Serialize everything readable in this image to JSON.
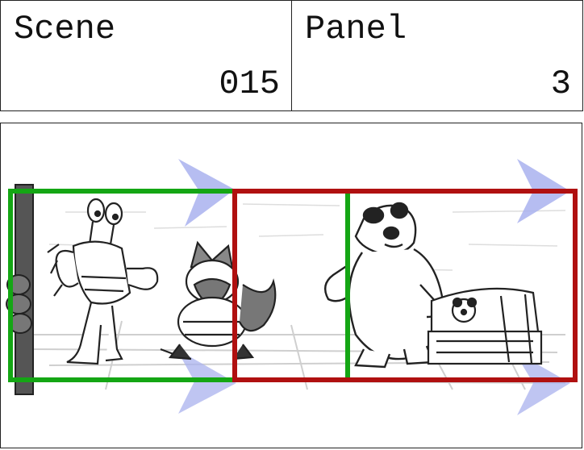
{
  "scene": {
    "label": "Scene",
    "number": "015"
  },
  "panel": {
    "label": "Panel",
    "number": "3"
  },
  "colors": {
    "frame_green": "#14a614",
    "frame_red": "#b01010",
    "arrow": "#a9b1ee",
    "sketch": "#222222"
  },
  "drawing": {
    "characters": [
      "crab-character",
      "cat-character",
      "polar-bear-character"
    ],
    "props": [
      "treasure-chest",
      "wooden-post"
    ]
  }
}
